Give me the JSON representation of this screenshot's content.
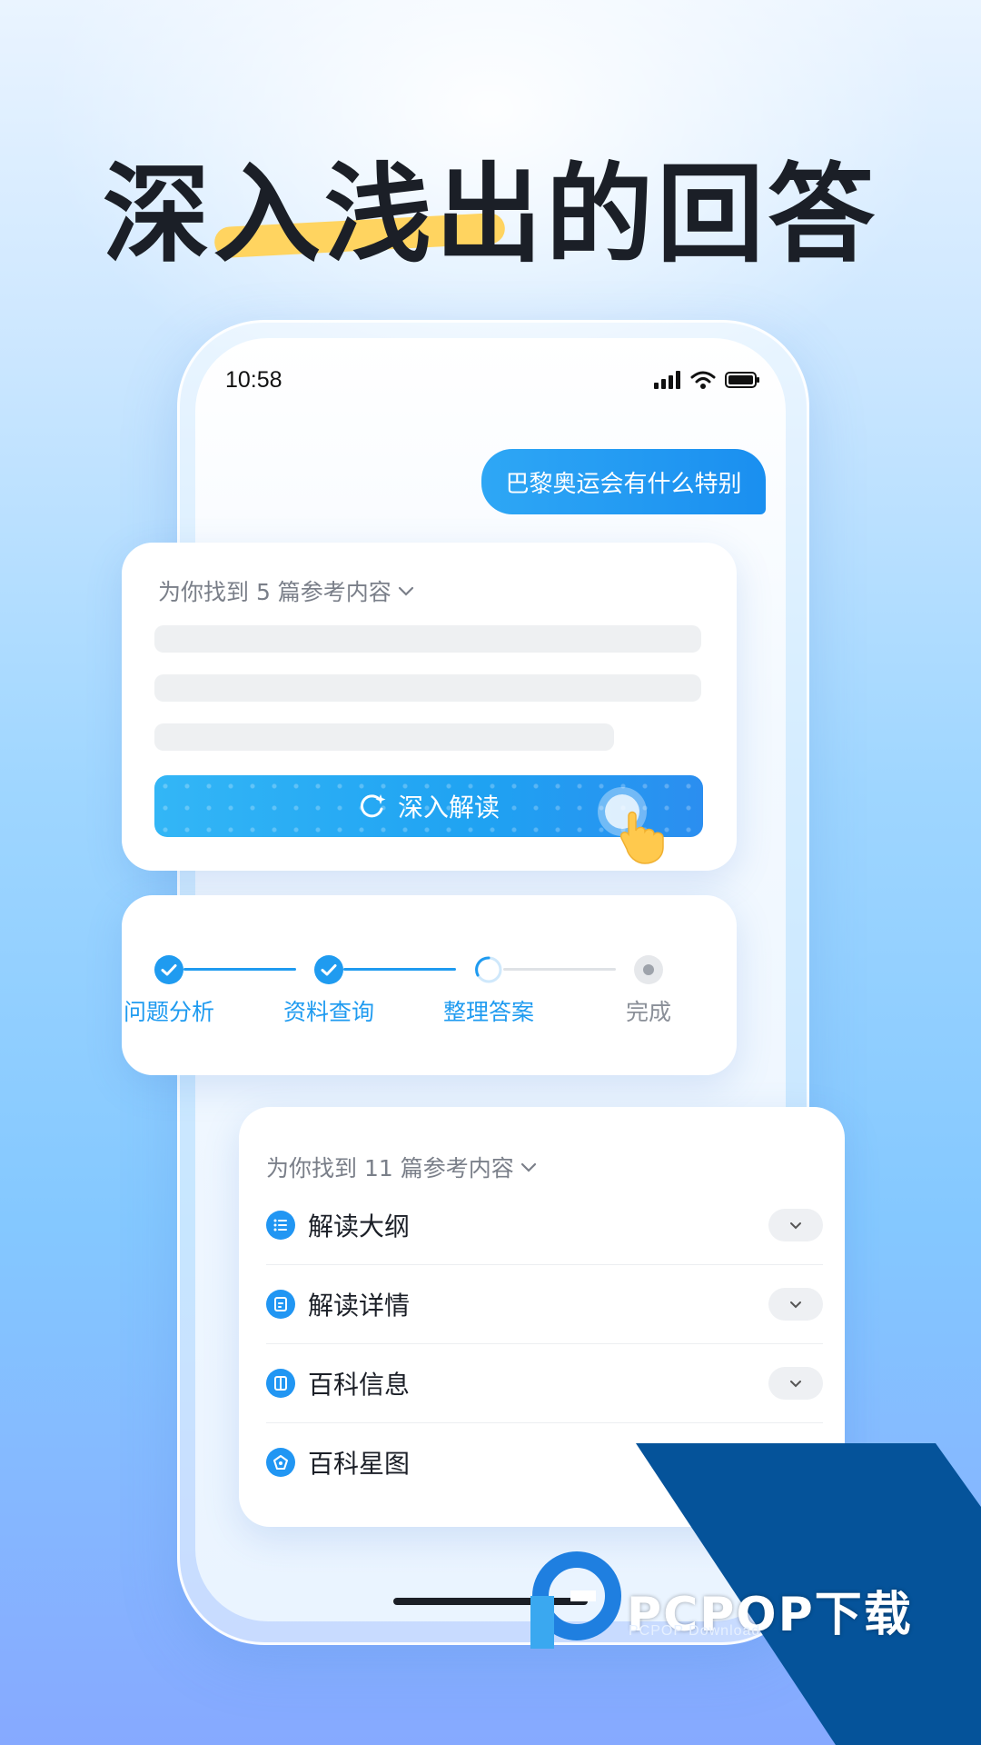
{
  "headline": "深入浅出的回答",
  "status_bar": {
    "time": "10:58"
  },
  "chat": {
    "user_message": "巴黎奥运会有什么特别"
  },
  "card_a": {
    "ref_header": "为你找到 5 篇参考内容",
    "deep_read_button": "深入解读"
  },
  "progress": {
    "steps": [
      {
        "label": "问题分析",
        "state": "done"
      },
      {
        "label": "资料查询",
        "state": "done"
      },
      {
        "label": "整理答案",
        "state": "in-progress"
      },
      {
        "label": "完成",
        "state": "pending"
      }
    ]
  },
  "card_c": {
    "ref_header": "为你找到 11 篇参考内容",
    "rows": [
      {
        "label": "解读大纲",
        "icon": "list-icon"
      },
      {
        "label": "解读详情",
        "icon": "document-icon"
      },
      {
        "label": "百科信息",
        "icon": "book-icon"
      },
      {
        "label": "百科星图",
        "icon": "star-graph-icon"
      }
    ]
  },
  "watermark": {
    "brand": "PCPOP下载",
    "sub": "PCPOP Download"
  },
  "colors": {
    "accent": "#1f9bf0",
    "highlight": "#ffd460",
    "watermark": "#05539a"
  }
}
